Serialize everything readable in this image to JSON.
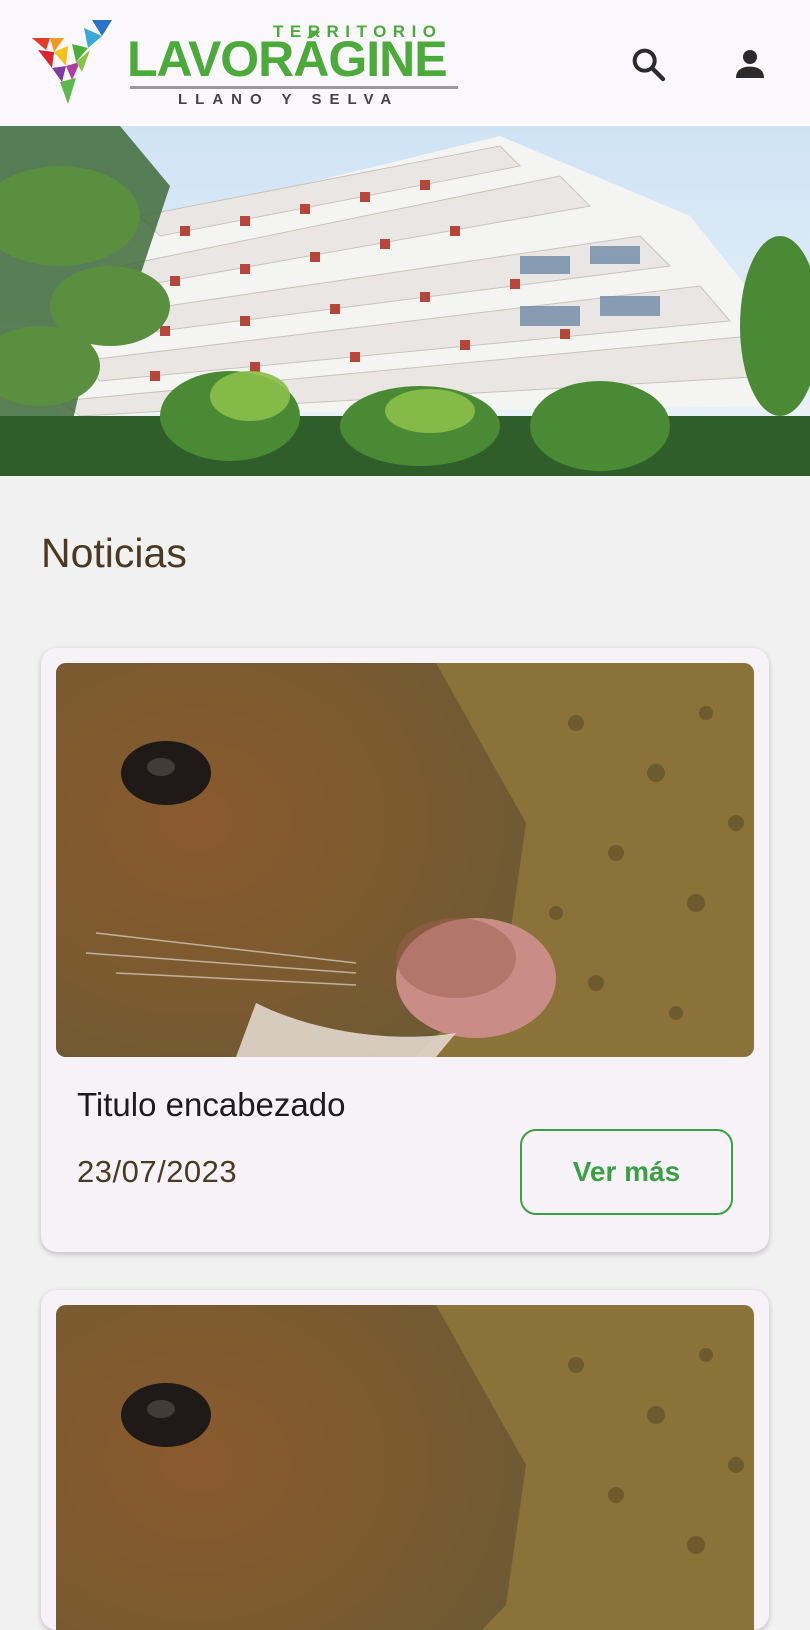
{
  "header": {
    "logo": {
      "top_text": "TERRITORIO",
      "main_text": "LAVORÁGINE",
      "sub_text": "LLANO Y SELVA"
    },
    "search_icon": "search-icon",
    "account_icon": "account-icon"
  },
  "hero": {
    "image": "hotel-building-photo"
  },
  "news": {
    "title": "Noticias",
    "cards": [
      {
        "image": "rodent-closeup-photo",
        "title": "Titulo encabezado",
        "date": "23/07/2023",
        "button_label": "Ver más"
      },
      {
        "image": "rodent-closeup-photo"
      }
    ]
  },
  "colors": {
    "accent": "#3aa043",
    "brand_green": "#4caa3a",
    "title_brown": "#4a3a22",
    "header_bg": "#fbf8fd",
    "card_bg": "#f6f2f8"
  }
}
